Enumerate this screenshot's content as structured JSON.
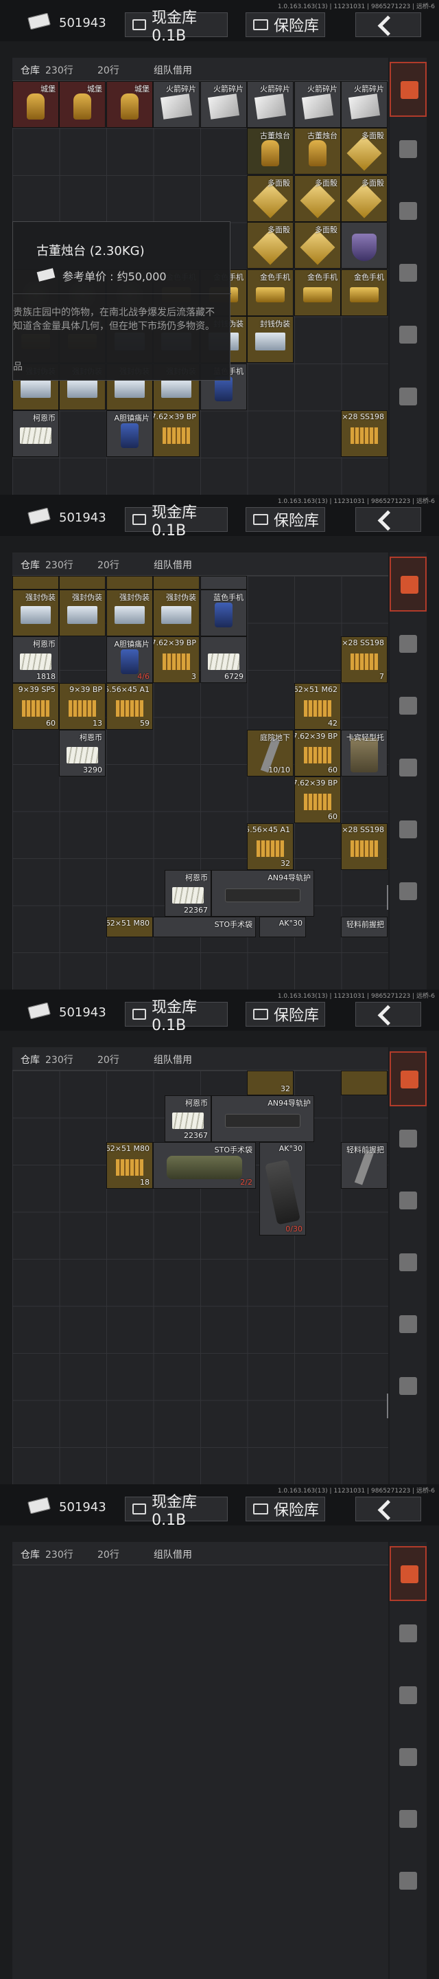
{
  "header": {
    "cash": "501943",
    "cash_vault_label": "现金库 0.1B",
    "safe_label": "保险库",
    "version": "1.0.163.163(13) | 11231031 | 9865271223 | 远桥-6"
  },
  "warehouse": {
    "label": "仓库",
    "rows": "230行",
    "cols": "20行",
    "team_borrow": "组队借用"
  },
  "tooltip": {
    "title": "古董烛台 (2.30KG)",
    "price": "参考单价 : 约50,000",
    "desc": "贵族庄园中的饰物，在南北战争爆发后流落藏不知道含金量具体几何，但在地下市场仍多物资。",
    "footer": "品"
  },
  "items": {
    "castle": "城堡",
    "fire_rocket_shard": "火箭碎片",
    "antique_candle": "古董烛台",
    "multi_cube": "多面骰",
    "gold_phone": "金色手机",
    "sealed_forgery": "强封伪装",
    "sealed_forgery2": "封钱伪装",
    "blue_phone": "蓝色手机",
    "keyli_coin": "柯恩币",
    "a_tablet": "A胆镇痛片",
    "ammo_762_39_bp": "7.62×39 BP",
    "ammo_57_28": "5.7×28 SS198",
    "ammo_9_39": "9×39 SP5",
    "ammo_9_39b": "9×39 BP",
    "ammo_556_45": "5.56×45 A1",
    "ammo_762_51": "7.62×51 M62",
    "ammo_762_51_m80": "7.62×51 M80",
    "underground_key": "庭院地下",
    "grip": "卡宾轻型托",
    "an94_rail": "AN94导轨护",
    "sto_bag": "STO手术袋",
    "ak30": "AK°30",
    "light_grip": "轻料前握把"
  },
  "counts": {
    "coin1": "1818",
    "tablet": "4/6",
    "bp1": "3",
    "blue1": "6729",
    "ss198": "7",
    "sp5": "60",
    "bp2": "13",
    "a1": "59",
    "m62": "42",
    "coin2": "3290",
    "key": "10/10",
    "bp3": "60",
    "bp4": "60",
    "a1b": "32",
    "coin3": "22367",
    "m80": "18",
    "sto": "2/2",
    "ak30": "0/30",
    "m80b": "32"
  }
}
